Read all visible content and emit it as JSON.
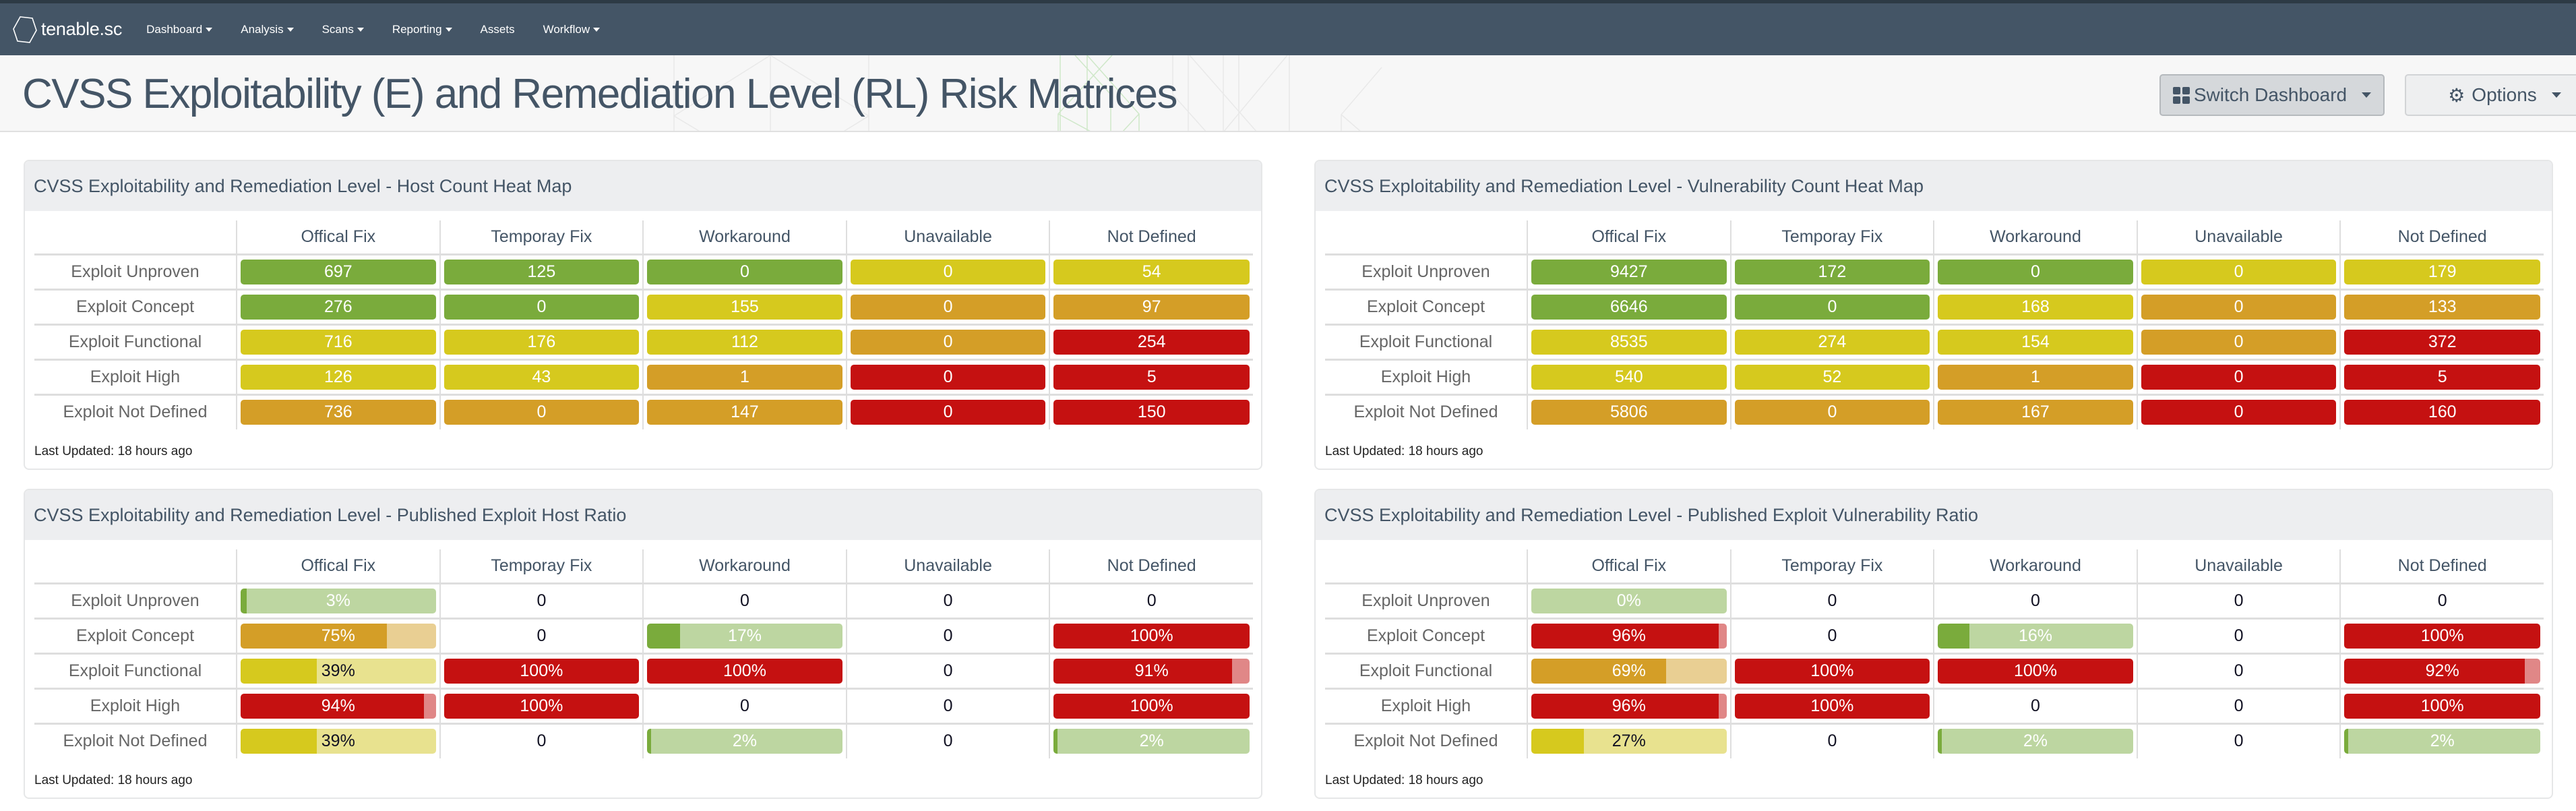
{
  "app": {
    "logo_text": "tenable.sc",
    "nav": [
      {
        "label": "Dashboard",
        "dropdown": true
      },
      {
        "label": "Analysis",
        "dropdown": true
      },
      {
        "label": "Scans",
        "dropdown": true
      },
      {
        "label": "Reporting",
        "dropdown": true
      },
      {
        "label": "Assets",
        "dropdown": false
      },
      {
        "label": "Workflow",
        "dropdown": true
      }
    ]
  },
  "page": {
    "title": "CVSS Exploitability (E) and Remediation Level (RL) Risk Matrices",
    "switch_dashboard_label": "Switch Dashboard",
    "options_label": "Options"
  },
  "colors": {
    "green": "#7aab3c",
    "yellow": "#d6c91e",
    "orange": "#d49e27",
    "red": "#c51111",
    "green_light": "#bdd6a1",
    "yellow_light": "#e8e28f",
    "orange_light": "#e9cf93",
    "red_light": "#e08787"
  },
  "columns": [
    "Offical Fix",
    "Temporay Fix",
    "Workaround",
    "Unavailable",
    "Not Defined"
  ],
  "rows": [
    "Exploit Unproven",
    "Exploit Concept",
    "Exploit Functional",
    "Exploit High",
    "Exploit Not Defined"
  ],
  "panels": [
    {
      "title": "CVSS Exploitability and Remediation Level - Host Count Heat Map",
      "type": "heatmap",
      "last_updated": "Last Updated: 18 hours ago",
      "cells": [
        [
          {
            "v": "697",
            "c": "green"
          },
          {
            "v": "125",
            "c": "green"
          },
          {
            "v": "0",
            "c": "green"
          },
          {
            "v": "0",
            "c": "yellow"
          },
          {
            "v": "54",
            "c": "yellow"
          }
        ],
        [
          {
            "v": "276",
            "c": "green"
          },
          {
            "v": "0",
            "c": "green"
          },
          {
            "v": "155",
            "c": "yellow"
          },
          {
            "v": "0",
            "c": "orange"
          },
          {
            "v": "97",
            "c": "orange"
          }
        ],
        [
          {
            "v": "716",
            "c": "yellow"
          },
          {
            "v": "176",
            "c": "yellow"
          },
          {
            "v": "112",
            "c": "yellow"
          },
          {
            "v": "0",
            "c": "orange"
          },
          {
            "v": "254",
            "c": "red"
          }
        ],
        [
          {
            "v": "126",
            "c": "yellow"
          },
          {
            "v": "43",
            "c": "yellow"
          },
          {
            "v": "1",
            "c": "orange"
          },
          {
            "v": "0",
            "c": "red"
          },
          {
            "v": "5",
            "c": "red"
          }
        ],
        [
          {
            "v": "736",
            "c": "orange"
          },
          {
            "v": "0",
            "c": "orange"
          },
          {
            "v": "147",
            "c": "orange"
          },
          {
            "v": "0",
            "c": "red"
          },
          {
            "v": "150",
            "c": "red"
          }
        ]
      ]
    },
    {
      "title": "CVSS Exploitability and Remediation Level - Vulnerability Count Heat Map",
      "type": "heatmap",
      "last_updated": "Last Updated: 18 hours ago",
      "cells": [
        [
          {
            "v": "9427",
            "c": "green"
          },
          {
            "v": "172",
            "c": "green"
          },
          {
            "v": "0",
            "c": "green"
          },
          {
            "v": "0",
            "c": "yellow"
          },
          {
            "v": "179",
            "c": "yellow"
          }
        ],
        [
          {
            "v": "6646",
            "c": "green"
          },
          {
            "v": "0",
            "c": "green"
          },
          {
            "v": "168",
            "c": "yellow"
          },
          {
            "v": "0",
            "c": "orange"
          },
          {
            "v": "133",
            "c": "orange"
          }
        ],
        [
          {
            "v": "8535",
            "c": "yellow"
          },
          {
            "v": "274",
            "c": "yellow"
          },
          {
            "v": "154",
            "c": "yellow"
          },
          {
            "v": "0",
            "c": "orange"
          },
          {
            "v": "372",
            "c": "red"
          }
        ],
        [
          {
            "v": "540",
            "c": "yellow"
          },
          {
            "v": "52",
            "c": "yellow"
          },
          {
            "v": "1",
            "c": "orange"
          },
          {
            "v": "0",
            "c": "red"
          },
          {
            "v": "5",
            "c": "red"
          }
        ],
        [
          {
            "v": "5806",
            "c": "orange"
          },
          {
            "v": "0",
            "c": "orange"
          },
          {
            "v": "167",
            "c": "orange"
          },
          {
            "v": "0",
            "c": "red"
          },
          {
            "v": "160",
            "c": "red"
          }
        ]
      ]
    },
    {
      "title": "CVSS Exploitability and Remediation Level - Published Exploit Host Ratio",
      "type": "ratio",
      "last_updated": "Last Updated: 18 hours ago",
      "cells": [
        [
          {
            "v": "3%",
            "pct": 3,
            "c": "green"
          },
          {
            "v": "0"
          },
          {
            "v": "0"
          },
          {
            "v": "0"
          },
          {
            "v": "0"
          }
        ],
        [
          {
            "v": "75%",
            "pct": 75,
            "c": "orange"
          },
          {
            "v": "0"
          },
          {
            "v": "17%",
            "pct": 17,
            "c": "green"
          },
          {
            "v": "0"
          },
          {
            "v": "100%",
            "pct": 100,
            "c": "red"
          }
        ],
        [
          {
            "v": "39%",
            "pct": 39,
            "c": "yellow",
            "dark": true
          },
          {
            "v": "100%",
            "pct": 100,
            "c": "red"
          },
          {
            "v": "100%",
            "pct": 100,
            "c": "red"
          },
          {
            "v": "0"
          },
          {
            "v": "91%",
            "pct": 91,
            "c": "red"
          }
        ],
        [
          {
            "v": "94%",
            "pct": 94,
            "c": "red"
          },
          {
            "v": "100%",
            "pct": 100,
            "c": "red"
          },
          {
            "v": "0"
          },
          {
            "v": "0"
          },
          {
            "v": "100%",
            "pct": 100,
            "c": "red"
          }
        ],
        [
          {
            "v": "39%",
            "pct": 39,
            "c": "yellow",
            "dark": true
          },
          {
            "v": "0"
          },
          {
            "v": "2%",
            "pct": 2,
            "c": "green"
          },
          {
            "v": "0"
          },
          {
            "v": "2%",
            "pct": 2,
            "c": "green"
          }
        ]
      ]
    },
    {
      "title": "CVSS Exploitability and Remediation Level - Published Exploit Vulnerability Ratio",
      "type": "ratio",
      "last_updated": "Last Updated: 18 hours ago",
      "cells": [
        [
          {
            "v": "0%",
            "pct": 0,
            "c": "green"
          },
          {
            "v": "0"
          },
          {
            "v": "0"
          },
          {
            "v": "0"
          },
          {
            "v": "0"
          }
        ],
        [
          {
            "v": "96%",
            "pct": 96,
            "c": "red"
          },
          {
            "v": "0"
          },
          {
            "v": "16%",
            "pct": 16,
            "c": "green"
          },
          {
            "v": "0"
          },
          {
            "v": "100%",
            "pct": 100,
            "c": "red"
          }
        ],
        [
          {
            "v": "69%",
            "pct": 69,
            "c": "orange"
          },
          {
            "v": "100%",
            "pct": 100,
            "c": "red"
          },
          {
            "v": "100%",
            "pct": 100,
            "c": "red"
          },
          {
            "v": "0"
          },
          {
            "v": "92%",
            "pct": 92,
            "c": "red"
          }
        ],
        [
          {
            "v": "96%",
            "pct": 96,
            "c": "red"
          },
          {
            "v": "100%",
            "pct": 100,
            "c": "red"
          },
          {
            "v": "0"
          },
          {
            "v": "0"
          },
          {
            "v": "100%",
            "pct": 100,
            "c": "red"
          }
        ],
        [
          {
            "v": "27%",
            "pct": 27,
            "c": "yellow",
            "dark": true
          },
          {
            "v": "0"
          },
          {
            "v": "2%",
            "pct": 2,
            "c": "green"
          },
          {
            "v": "0"
          },
          {
            "v": "2%",
            "pct": 2,
            "c": "green"
          }
        ]
      ]
    }
  ]
}
